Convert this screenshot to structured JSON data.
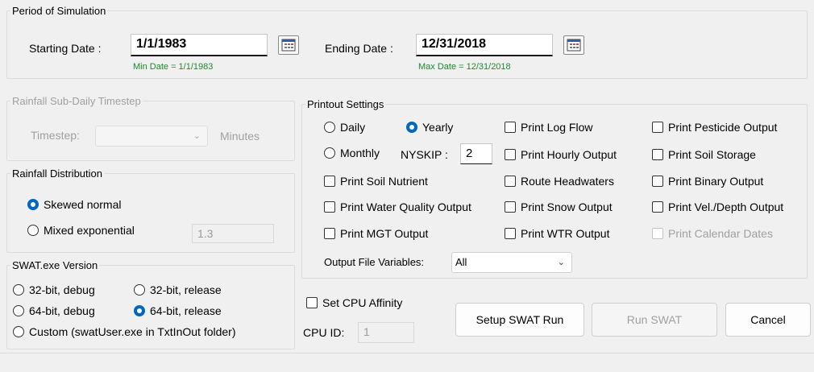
{
  "period": {
    "legend": "Period of Simulation",
    "start_label": "Starting Date :",
    "start_value": "1/1/1983",
    "min_date": "Min Date = 1/1/1983",
    "end_label": "Ending Date :",
    "end_value": "12/31/2018",
    "max_date": "Max Date = 12/31/2018"
  },
  "rainfall_timestep": {
    "legend": "Rainfall Sub-Daily Timestep",
    "timestep_label": "Timestep:",
    "timestep_value": "",
    "unit": "Minutes"
  },
  "rainfall_distribution": {
    "legend": "Rainfall Distribution",
    "options": [
      "Skewed normal",
      "Mixed exponential"
    ],
    "selected": "Skewed normal",
    "exponent": "1.3"
  },
  "swat_version": {
    "legend": "SWAT.exe Version",
    "options": [
      "32-bit, debug",
      "32-bit, release",
      "64-bit, debug",
      "64-bit, release",
      "Custom (swatUser.exe in TxtInOut folder)"
    ],
    "selected": "64-bit, release"
  },
  "printout": {
    "legend": "Printout Settings",
    "freq": [
      "Daily",
      "Yearly",
      "Monthly"
    ],
    "freq_selected": "Yearly",
    "nyskip_label": "NYSKIP :",
    "nyskip_value": "2",
    "checks": [
      "Print Log Flow",
      "Print Pesticide Output",
      "Print Hourly Output",
      "Print Soil Storage",
      "Print Soil Nutrient",
      "Route Headwaters",
      "Print Binary Output",
      "Print Water Quality Output",
      "Print Snow Output",
      "Print Vel./Depth Output",
      "Print MGT Output",
      "Print WTR Output",
      "Print Calendar Dates"
    ],
    "output_vars_label": "Output File Variables:",
    "output_vars_value": "All"
  },
  "cpu": {
    "affinity_label": "Set CPU Affinity",
    "id_label": "CPU ID:",
    "id_value": "1"
  },
  "buttons": {
    "setup": "Setup SWAT Run",
    "run": "Run SWAT",
    "cancel": "Cancel"
  },
  "colors": {
    "accent": "#0067c0",
    "hint_green": "#1e8a2e",
    "disabled": "#a0a0a0"
  },
  "icons": {
    "calendar": "calendar-icon",
    "dropdown": "chevron-down-icon"
  }
}
